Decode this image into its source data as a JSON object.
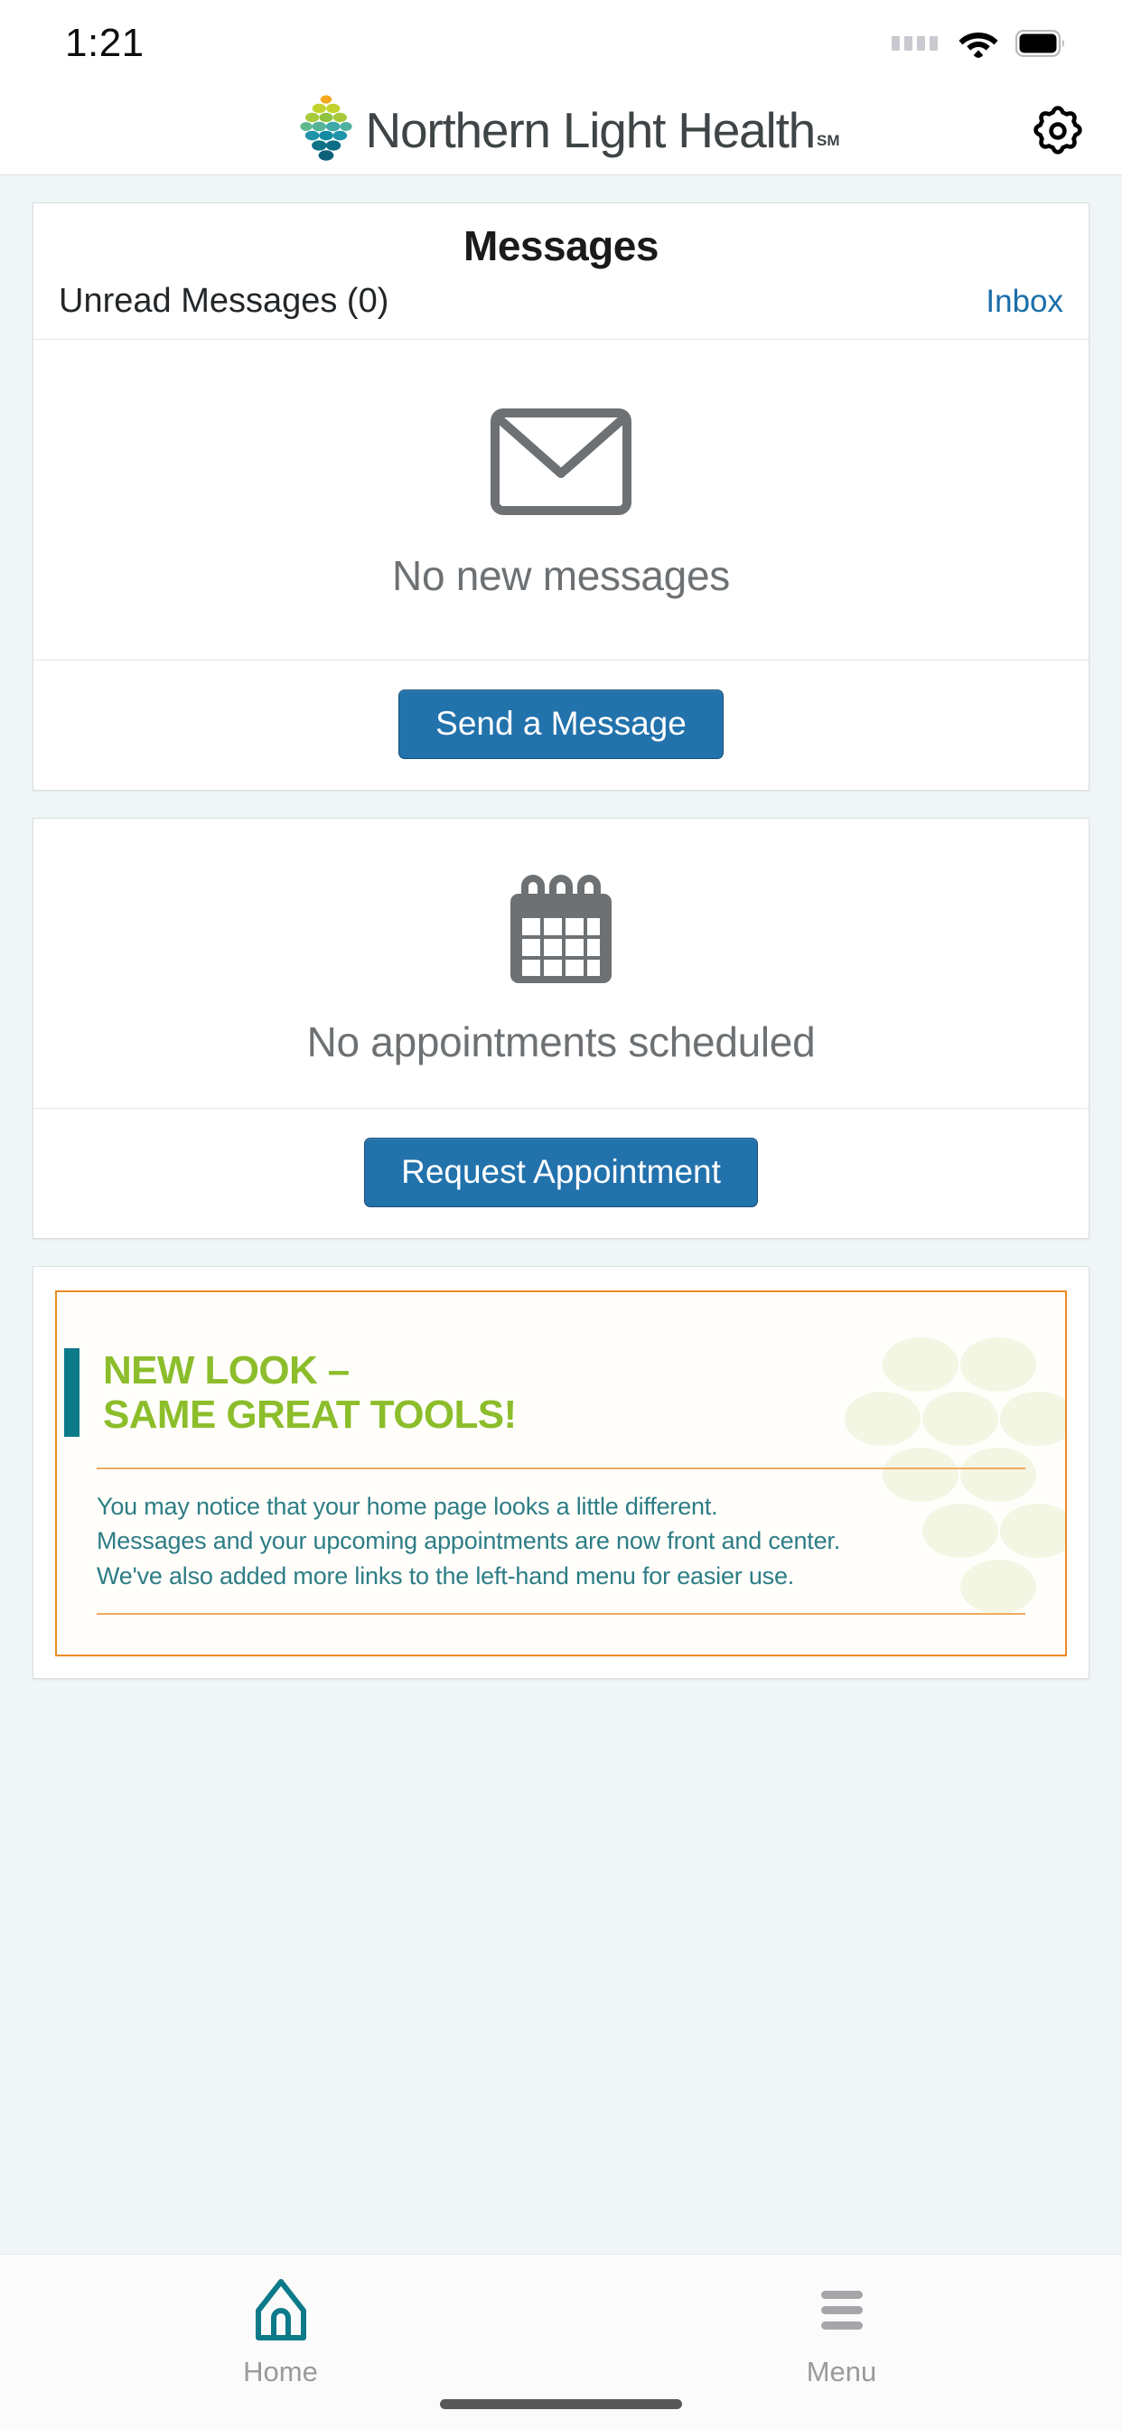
{
  "status_bar": {
    "time": "1:21",
    "signal_icon": "signal-dots-icon",
    "wifi_icon": "wifi-icon",
    "battery_icon": "battery-full-icon"
  },
  "header": {
    "brand_name": "Northern Light Health",
    "brand_service_mark": "SM",
    "logo_icon": "northern-light-leaf-logo",
    "settings_icon": "gear-icon",
    "logo_colors": [
      "#f5a81c",
      "#c3d22c",
      "#a7c93a",
      "#6fba7e",
      "#3fa8a8",
      "#1a8fa0",
      "#10768c",
      "#0e6b82",
      "#0d5f7a"
    ]
  },
  "messages_card": {
    "title": "Messages",
    "unread_label": "Unread Messages (0)",
    "inbox_link": "Inbox",
    "empty_icon": "envelope-icon",
    "empty_text": "No new messages",
    "action_button": "Send a Message"
  },
  "appointments_card": {
    "empty_icon": "calendar-icon",
    "empty_text": "No appointments scheduled",
    "action_button": "Request Appointment"
  },
  "promo_card": {
    "headline_line1": "NEW LOOK –",
    "headline_line2": "SAME GREAT TOOLS!",
    "body_line1": "You may notice that your home page looks a little different.",
    "body_line2": "Messages and your upcoming appointments are now front and center.",
    "body_line3": "We've also added more links to the left-hand menu for easier use.",
    "accent_bar_color": "#0d7a8a",
    "border_color": "#eb8b24",
    "headline_color": "#8cbd2a",
    "body_color": "#2d7d85"
  },
  "bottom_nav": {
    "items": [
      {
        "label": "Home",
        "icon": "home-icon",
        "active": true
      },
      {
        "label": "Menu",
        "icon": "hamburger-menu-icon",
        "active": false
      }
    ]
  },
  "colors": {
    "primary_button": "#2272ac",
    "link": "#1a6ea8",
    "page_background": "#f0f6f7",
    "active_nav": "#0d7a8a",
    "inactive_nav": "#9a9a9e"
  }
}
